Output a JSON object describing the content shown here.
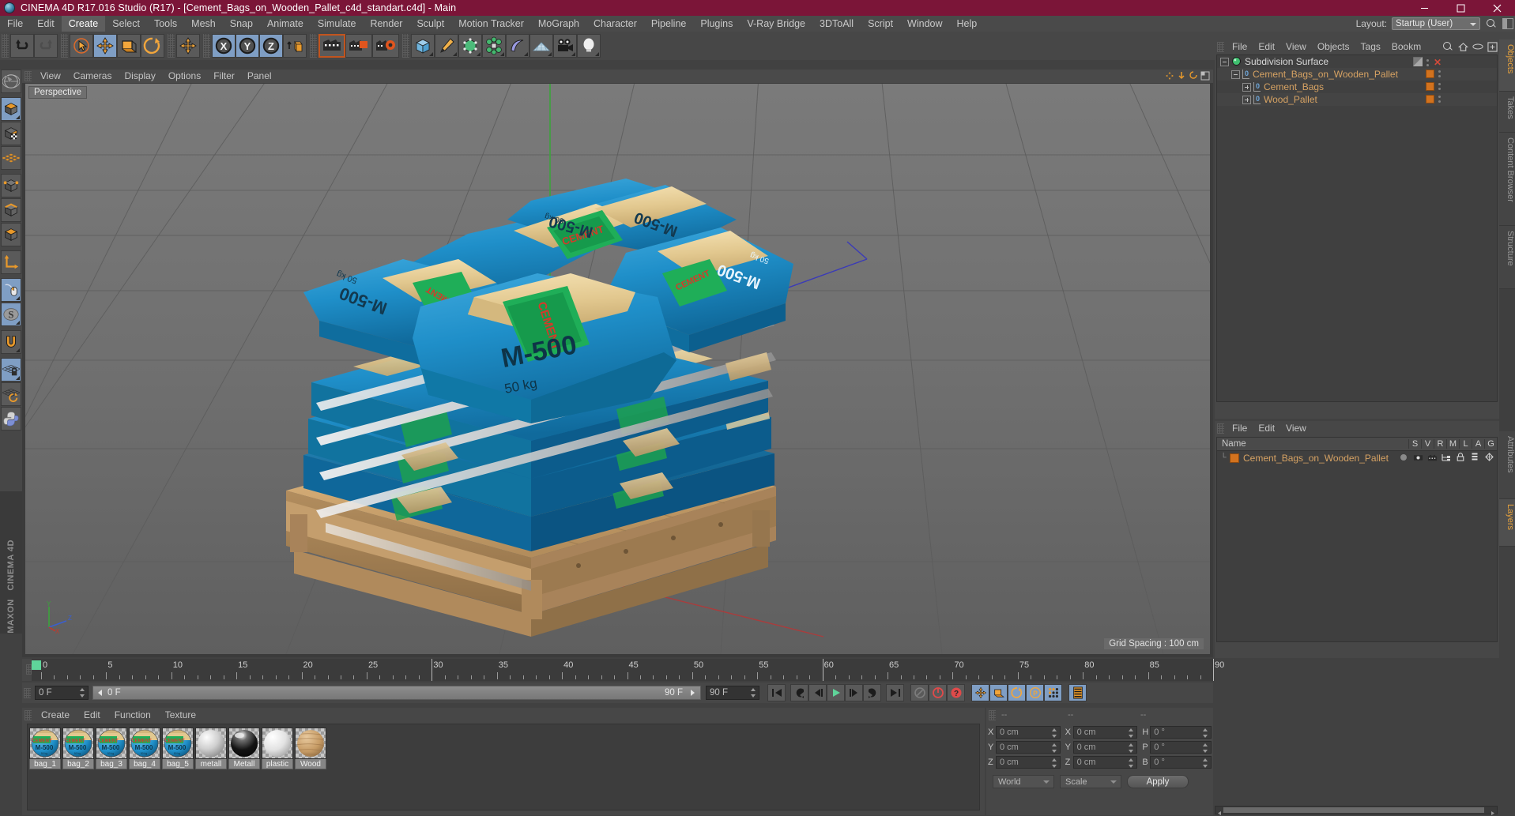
{
  "window": {
    "title": "CINEMA 4D R17.016 Studio (R17) - [Cement_Bags_on_Wooden_Pallet_c4d_standart.c4d] - Main",
    "app_icon": "cinema4d-logo-icon",
    "minimize": "—",
    "maximize": "☐",
    "close": "✕",
    "titlebar_color": "#7b1538"
  },
  "menubar": {
    "items": [
      "File",
      "Edit",
      "Create",
      "Select",
      "Tools",
      "Mesh",
      "Snap",
      "Animate",
      "Simulate",
      "Render",
      "Sculpt",
      "Motion Tracker",
      "MoGraph",
      "Character",
      "Pipeline",
      "Plugins",
      "V-Ray Bridge",
      "3DToAll",
      "Script",
      "Window",
      "Help"
    ],
    "active": "Create",
    "layout_label": "Layout:",
    "layout_value": "Startup (User)"
  },
  "toolbar": {
    "buttons": [
      {
        "name": "undo-button",
        "on": false
      },
      {
        "name": "redo-button",
        "on": false
      },
      {
        "name": "live-selection-tool",
        "on": false
      },
      {
        "name": "move-tool",
        "on": true
      },
      {
        "name": "scale-tool",
        "on": false
      },
      {
        "name": "rotate-tool",
        "on": false
      },
      {
        "name": "axis-move-tool",
        "on": false
      },
      {
        "name": "lock-x-axis",
        "on": true
      },
      {
        "name": "lock-y-axis",
        "on": true
      },
      {
        "name": "lock-z-axis",
        "on": true
      },
      {
        "name": "world-object-coordinates",
        "on": false
      },
      {
        "name": "render-view-button",
        "on": false
      },
      {
        "name": "render-to-picture-viewer-button",
        "on": false
      },
      {
        "name": "render-settings-button",
        "on": false
      },
      {
        "name": "add-cube-button",
        "on": false
      },
      {
        "name": "add-spline-button",
        "on": false
      },
      {
        "name": "add-generator-button",
        "on": false
      },
      {
        "name": "add-deformer-button",
        "on": false
      },
      {
        "name": "add-scene-object-button",
        "on": false
      },
      {
        "name": "add-floor-button",
        "on": false
      },
      {
        "name": "add-camera-button",
        "on": false
      },
      {
        "name": "add-light-button",
        "on": false
      }
    ]
  },
  "left_toolbar": {
    "buttons": [
      {
        "name": "make-editable-tool",
        "on": false
      },
      {
        "name": "model-mode-tool",
        "on": true
      },
      {
        "name": "texture-mode-tool",
        "on": false
      },
      {
        "name": "polygon-subdivide-tool",
        "on": false
      },
      {
        "name": "points-mode-tool",
        "on": false
      },
      {
        "name": "edges-mode-tool",
        "on": false
      },
      {
        "name": "polygons-mode-tool",
        "on": false
      },
      {
        "name": "axis-mode-tool",
        "on": false
      },
      {
        "name": "viewport-solo-tool",
        "on": true
      },
      {
        "name": "enable-snapping-tool",
        "on": true
      },
      {
        "name": "snap-settings-tool",
        "on": false
      },
      {
        "name": "lock-workplane-tool",
        "on": true
      },
      {
        "name": "workplane-tool",
        "on": false
      },
      {
        "name": "python-script-tool",
        "on": false
      }
    ],
    "brand_line1": "MAXON",
    "brand_line2": "CINEMA 4D"
  },
  "viewport": {
    "menu": [
      "View",
      "Cameras",
      "Display",
      "Options",
      "Filter",
      "Panel"
    ],
    "label": "Perspective",
    "grid_spacing": "Grid Spacing : 100 cm",
    "axis_labels": {
      "x": "X",
      "y": "Y",
      "z": "Z"
    },
    "scene": {
      "product_text_main": "M-500",
      "product_text_weight": "50 kg",
      "product_text_brand": "CEMENT",
      "bag_color": "#1f8fc9",
      "bag_top_color": "#e8cf9a",
      "label_color": "#16a34a",
      "pallet_color": "#c9a36c"
    }
  },
  "timeline": {
    "ticks": [
      0,
      5,
      10,
      15,
      20,
      25,
      30,
      35,
      40,
      45,
      50,
      55,
      60,
      65,
      70,
      75,
      80,
      85,
      90
    ],
    "start_frame": "0 F",
    "end_frame": "90 F",
    "current_frame": "0 F",
    "preview_start": "0 F",
    "preview_end": "90 F",
    "playhead_frame": "0 F",
    "current_frame_field": "0 F",
    "playback_buttons": [
      {
        "name": "go-to-start-button",
        "on": false
      },
      {
        "name": "go-to-previous-keyframe-button",
        "on": false
      },
      {
        "name": "step-back-button",
        "on": false
      },
      {
        "name": "play-button",
        "on": false
      },
      {
        "name": "step-forward-button",
        "on": false
      },
      {
        "name": "go-to-next-keyframe-button",
        "on": false
      },
      {
        "name": "go-to-end-button",
        "on": false
      },
      {
        "name": "record-active-objects-button",
        "on": false
      },
      {
        "name": "autokeying-button",
        "on": false
      },
      {
        "name": "keyframe-selection-button",
        "on": false
      },
      {
        "name": "position-key-button",
        "on": true
      },
      {
        "name": "scale-key-button",
        "on": true
      },
      {
        "name": "rotation-key-button",
        "on": true
      },
      {
        "name": "parameter-key-button",
        "on": true
      },
      {
        "name": "point-level-animation-button",
        "on": true
      },
      {
        "name": "timeline-settings-button",
        "on": true
      }
    ]
  },
  "materials": {
    "menu": [
      "Create",
      "Edit",
      "Function",
      "Texture"
    ],
    "items": [
      {
        "name": "bag_1",
        "kind": "bag"
      },
      {
        "name": "bag_2",
        "kind": "bag"
      },
      {
        "name": "bag_3",
        "kind": "bag"
      },
      {
        "name": "bag_4",
        "kind": "bag"
      },
      {
        "name": "bag_5",
        "kind": "bag"
      },
      {
        "name": "metall",
        "kind": "metal-light"
      },
      {
        "name": "Metall",
        "kind": "metal-dark"
      },
      {
        "name": "plastic",
        "kind": "plastic"
      },
      {
        "name": "Wood",
        "kind": "wood"
      }
    ]
  },
  "coordinates": {
    "headers": [
      "--",
      "--",
      "--"
    ],
    "rows": [
      {
        "axis1": "X",
        "value1": "0 cm",
        "axis2": "X",
        "value2": "0 cm",
        "axis3": "H",
        "value3": "0 °"
      },
      {
        "axis1": "Y",
        "value1": "0 cm",
        "axis2": "Y",
        "value2": "0 cm",
        "axis3": "P",
        "value3": "0 °"
      },
      {
        "axis1": "Z",
        "value1": "0 cm",
        "axis2": "Z",
        "value2": "0 cm",
        "axis3": "B",
        "value3": "0 °"
      }
    ],
    "system_select": "World",
    "mode_select": "Scale",
    "apply_label": "Apply"
  },
  "object_manager": {
    "menu": [
      "File",
      "Edit",
      "View",
      "Objects",
      "Tags",
      "Bookm"
    ],
    "icons": [
      "search-icon",
      "home-icon",
      "eye-icon",
      "fit-icon"
    ],
    "tree": [
      {
        "label": "Subdivision Surface",
        "depth": 0,
        "expander": "minus",
        "icon": "subdivision-surface-icon",
        "tag": "checker",
        "color": "#d8d8d8",
        "close": true
      },
      {
        "label": "Cement_Bags_on_Wooden_Pallet",
        "depth": 1,
        "expander": "minus",
        "icon": "null-object-icon",
        "tag": "orange",
        "color": "#d6a263"
      },
      {
        "label": "Cement_Bags",
        "depth": 2,
        "expander": "plus",
        "icon": "null-object-icon",
        "tag": "orange",
        "color": "#d6a263"
      },
      {
        "label": "Wood_Pallet",
        "depth": 2,
        "expander": "plus",
        "icon": "null-object-icon",
        "tag": "orange",
        "color": "#d6a263"
      }
    ]
  },
  "layer_manager": {
    "menu": [
      "File",
      "Edit",
      "View"
    ],
    "name_header": "Name",
    "columns": [
      "S",
      "V",
      "R",
      "M",
      "L",
      "A",
      "G"
    ],
    "rows": [
      {
        "label": "Cement_Bags_on_Wooden_Pallet",
        "color": "#d2721e"
      }
    ]
  },
  "right_tabs": {
    "top": [
      {
        "label": "Objects",
        "selected": true
      },
      {
        "label": "Takes",
        "selected": false
      },
      {
        "label": "Content Browser",
        "selected": false
      },
      {
        "label": "Structure",
        "selected": false
      }
    ],
    "bottom": [
      {
        "label": "Attributes",
        "selected": false
      },
      {
        "label": "Layers",
        "selected": true
      }
    ]
  }
}
